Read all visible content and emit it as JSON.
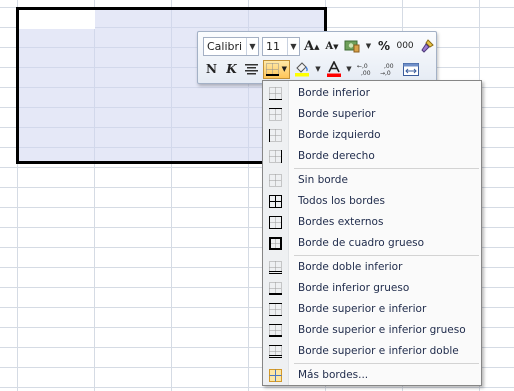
{
  "toolbar": {
    "font_name": "Calibri",
    "font_size": "11",
    "grow_font": "A",
    "shrink_font": "A",
    "percent": "%",
    "thousands": "000",
    "bold": "N",
    "italic": "K",
    "increase_decimal": "←,0 .00",
    "decrease_decimal": ".00 →,0"
  },
  "menu": {
    "items": [
      {
        "label": "Borde inferior",
        "icon": "border-bottom-icon"
      },
      {
        "label": "Borde superior",
        "icon": "border-top-icon"
      },
      {
        "label": "Borde izquierdo",
        "icon": "border-left-icon"
      },
      {
        "label": "Borde derecho",
        "icon": "border-right-icon"
      },
      {
        "label": "Sin borde",
        "icon": "no-border-icon"
      },
      {
        "label": "Todos los bordes",
        "icon": "all-borders-icon"
      },
      {
        "label": "Bordes externos",
        "icon": "outside-borders-icon"
      },
      {
        "label": "Borde de cuadro grueso",
        "icon": "thick-box-border-icon"
      },
      {
        "label": "Borde doble inferior",
        "icon": "bottom-double-border-icon"
      },
      {
        "label": "Borde inferior grueso",
        "icon": "thick-bottom-border-icon"
      },
      {
        "label": "Borde superior e inferior",
        "icon": "top-bottom-border-icon"
      },
      {
        "label": "Borde superior e inferior grueso",
        "icon": "top-thick-bottom-border-icon"
      },
      {
        "label": "Borde superior e inferior doble",
        "icon": "top-double-bottom-border-icon"
      },
      {
        "label": "Más bordes...",
        "icon": "more-borders-icon"
      }
    ]
  },
  "colors": {
    "fill_color": "#ffff00",
    "font_color": "#ff0000",
    "menu_label": "#1e2a4a",
    "selection": "#d0d6f0"
  }
}
